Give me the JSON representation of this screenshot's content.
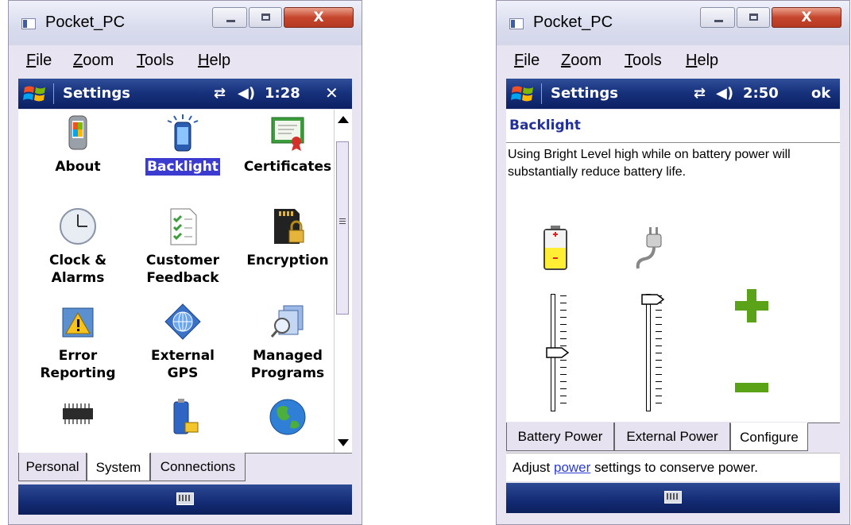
{
  "left": {
    "title": "Pocket_PC",
    "window_controls": {
      "minimize": "",
      "maximize": "",
      "close": "X"
    },
    "menu": [
      "File",
      "Zoom",
      "Tools",
      "Help"
    ],
    "taskbar": {
      "title": "Settings",
      "time": "1:28",
      "action": "✕"
    },
    "icons": [
      {
        "label": "About",
        "icon": "about-icon"
      },
      {
        "label": "Backlight",
        "icon": "backlight-icon",
        "selected": true
      },
      {
        "label": "Certificates",
        "icon": "certificates-icon"
      },
      {
        "label": "Clock &\nAlarms",
        "icon": "clock-icon"
      },
      {
        "label": "Customer\nFeedback",
        "icon": "feedback-icon"
      },
      {
        "label": "Encryption",
        "icon": "encryption-icon"
      },
      {
        "label": "Error\nReporting",
        "icon": "error-icon"
      },
      {
        "label": "External\nGPS",
        "icon": "gps-icon"
      },
      {
        "label": "Managed\nPrograms",
        "icon": "managed-programs-icon"
      },
      {
        "label": "",
        "icon": "memory-icon"
      },
      {
        "label": "",
        "icon": "power-icon"
      },
      {
        "label": "",
        "icon": "regional-icon"
      }
    ],
    "tabs": [
      "Personal",
      "System",
      "Connections"
    ],
    "active_tab": "System"
  },
  "right": {
    "title": "Pocket_PC",
    "window_controls": {
      "minimize": "",
      "maximize": "",
      "close": "X"
    },
    "menu": [
      "File",
      "Zoom",
      "Tools",
      "Help"
    ],
    "taskbar": {
      "title": "Settings",
      "time": "2:50",
      "action": "ok"
    },
    "header": "Backlight",
    "description": "Using Bright Level high while on battery power will substantially reduce battery life.",
    "battery_level": 0.5,
    "external_level": 1.0,
    "plus_label": "+",
    "minus_label": "−",
    "tabs": [
      "Battery Power",
      "External Power",
      "Configure"
    ],
    "active_tab": "Configure",
    "hint_prefix": "Adjust ",
    "hint_link": "power",
    "hint_suffix": " settings to conserve power."
  },
  "colors": {
    "taskbar": "#16307a",
    "selection": "#3b3bd0",
    "header": "#21309a",
    "plus_minus": "#5aa319"
  }
}
